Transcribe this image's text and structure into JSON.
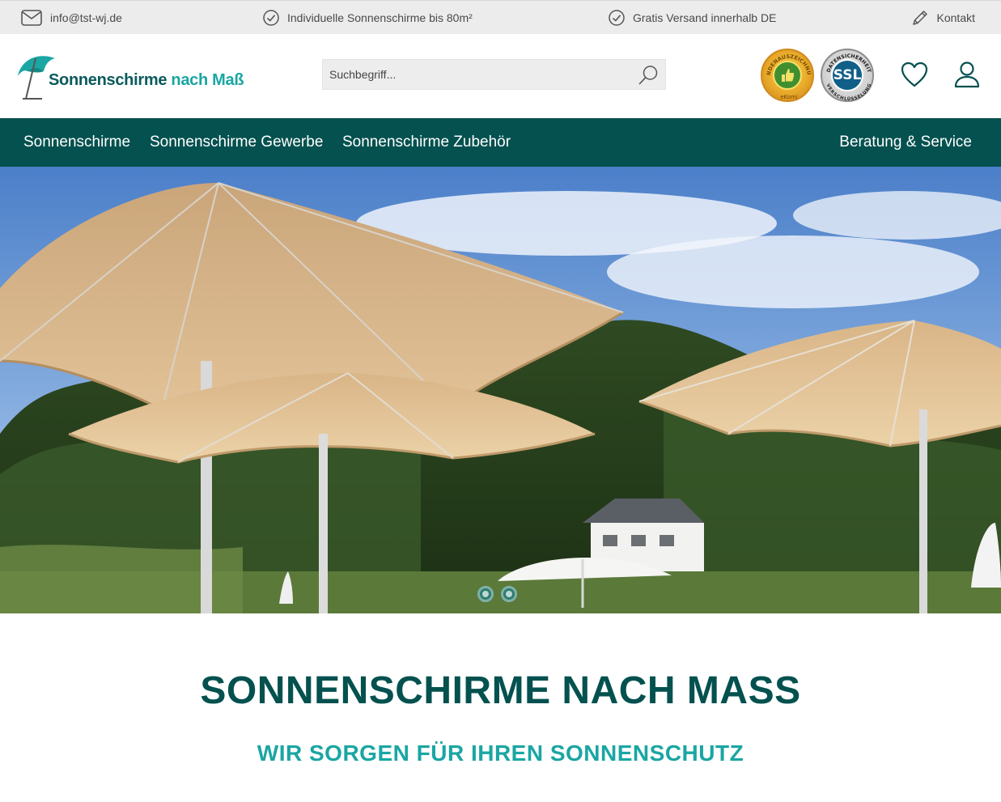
{
  "topbar": {
    "email": "info@tst-wj.de",
    "custom": "Individuelle Sonnenschirme bis 80m²",
    "shipping": "Gratis Versand innerhalb DE",
    "contact": "Kontakt"
  },
  "header": {
    "logo_part1": "Sonnenschirme",
    "logo_part2": "nach Maß",
    "search_placeholder": "Suchbegriff...",
    "ssl_text": "SSL",
    "ekomi_ring": "KUNDENAUSZEICHNUNG",
    "ekomi_brand": "eKomi",
    "ssl_ring": "DATENSICHERHEIT",
    "ssl_ring_bottom": "VERSCHLÜSSELUNG"
  },
  "nav": {
    "items": [
      {
        "label": "Sonnenschirme"
      },
      {
        "label": "Sonnenschirme Gewerbe"
      },
      {
        "label": "Sonnenschirme Zubehör"
      },
      {
        "label": "Beratung & Service"
      }
    ]
  },
  "main": {
    "title": "SONNENSCHIRME NACH MASS",
    "subtitle": "WIR SORGEN FÜR IHREN SONNENSCHUTZ"
  },
  "colors": {
    "nav_bg": "#04514f",
    "accent_teal": "#1aa6a3",
    "title_green": "#04514f"
  }
}
